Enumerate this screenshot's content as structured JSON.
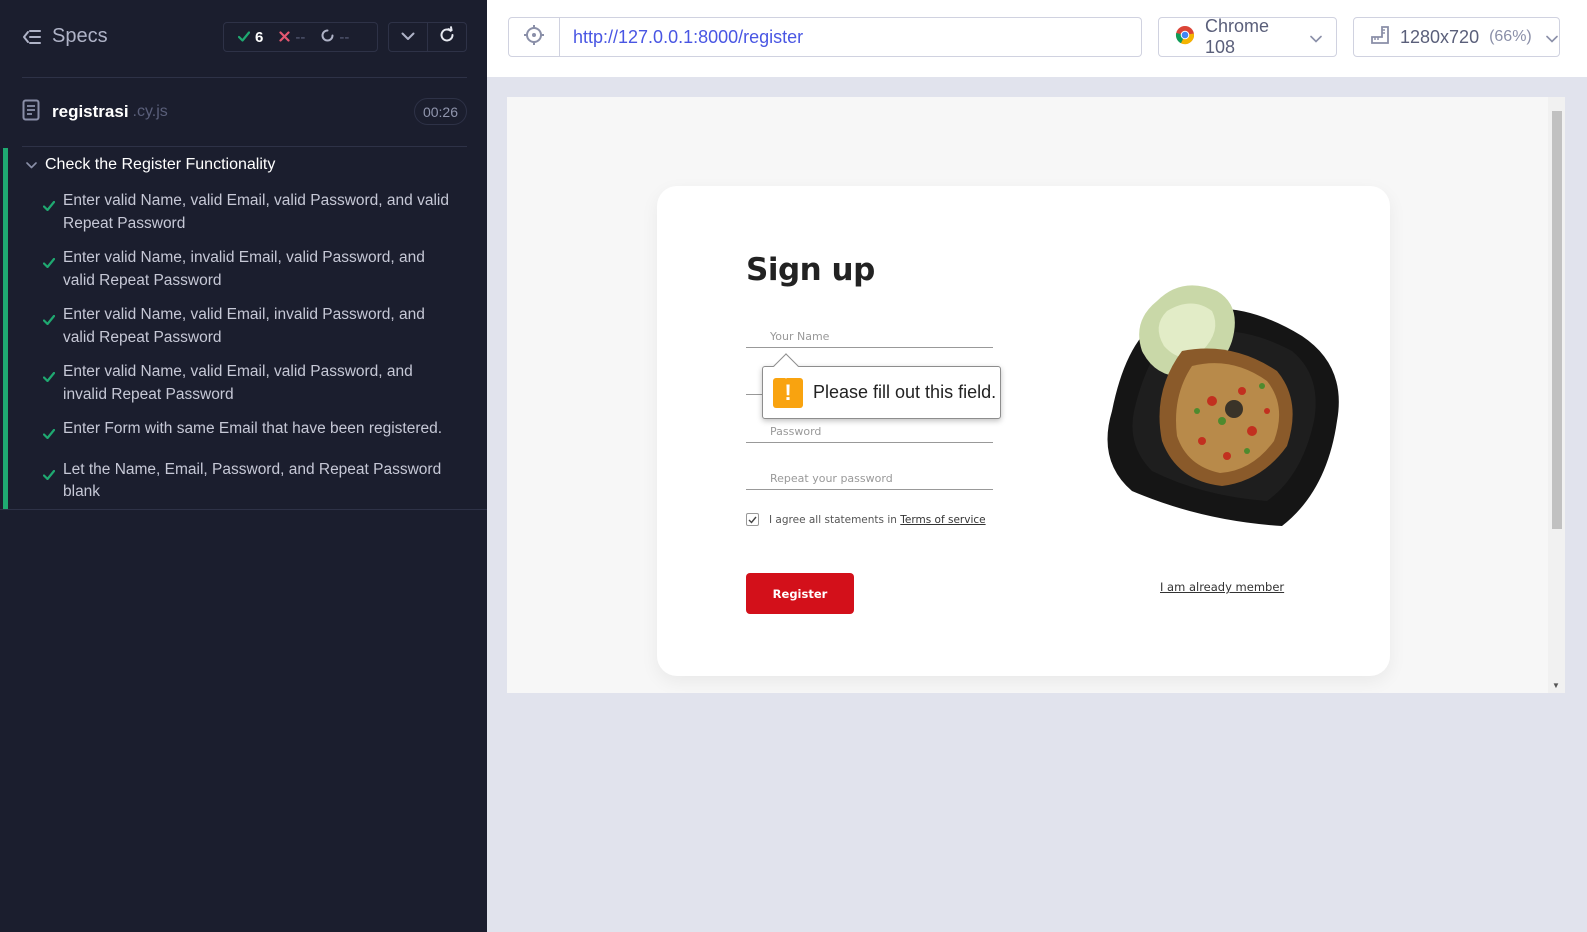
{
  "sidebar": {
    "specs_label": "Specs",
    "stats": {
      "passed": "6",
      "failed": "--",
      "pending": "--"
    },
    "file": {
      "name": "registrasi",
      "ext": ".cy.js",
      "duration": "00:26"
    },
    "suite_title": "Check the Register Functionality",
    "tests": [
      {
        "label": "Enter valid Name, valid Email, valid Password, and valid Repeat Password",
        "status": "passed"
      },
      {
        "label": "Enter valid Name, invalid Email, valid Password, and valid Repeat Password",
        "status": "passed"
      },
      {
        "label": "Enter valid Name, valid Email, invalid Password, and valid Repeat Password",
        "status": "passed"
      },
      {
        "label": "Enter valid Name, valid Email, valid Password, and invalid Repeat Password",
        "status": "passed"
      },
      {
        "label": "Enter Form with same Email that have been registered.",
        "status": "passed"
      },
      {
        "label": "Let the Name, Email, Password, and Repeat Password blank",
        "status": "passed"
      }
    ]
  },
  "toolbar": {
    "url": "http://127.0.0.1:8000/register",
    "browser": "Chrome 108",
    "viewport": "1280x720",
    "scale": "(66%)"
  },
  "form": {
    "title": "Sign up",
    "name_placeholder": "Your Name",
    "email_placeholder": "",
    "password_placeholder": "Password",
    "repeat_placeholder": "Repeat your password",
    "agree_text": "I agree all statements in",
    "tos_link": "Terms of service",
    "register_label": "Register",
    "member_link": "I am already member",
    "validation_message": "Please fill out this field."
  },
  "colors": {
    "sidebar_bg": "#1b1e2e",
    "passed": "#1fa971",
    "failed": "#e45770",
    "url_text": "#4956e3",
    "register_button": "#d3101a",
    "warning": "#f9a30f"
  }
}
